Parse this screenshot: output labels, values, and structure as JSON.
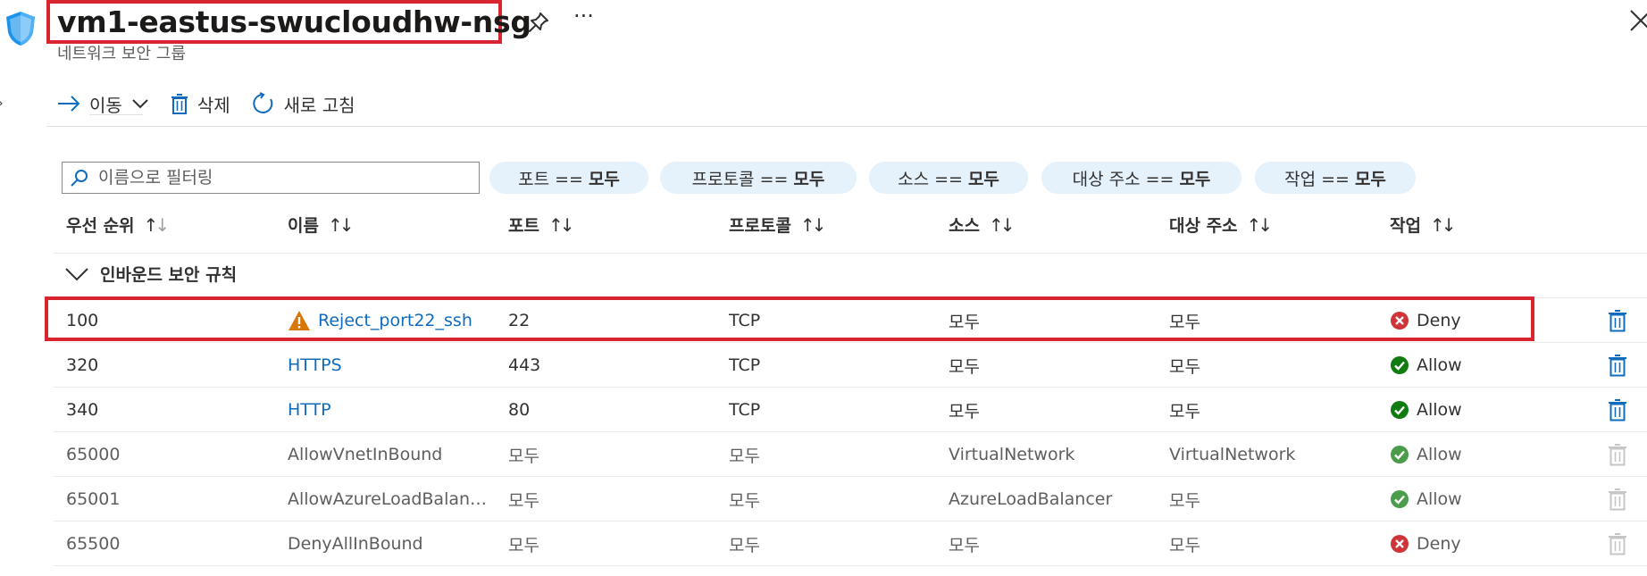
{
  "header": {
    "title": "vm1-eastus-swucloudhw-nsg",
    "subtitle": "네트워크 보안 그룹",
    "more": "···"
  },
  "toolbar": {
    "move_label": "이동",
    "delete_label": "삭제",
    "refresh_label": "새로 고침"
  },
  "filters": {
    "search_placeholder": "이름으로 필터링",
    "pills": [
      {
        "name": "포트 ==",
        "value": "모두"
      },
      {
        "name": "프로토콜 ==",
        "value": "모두"
      },
      {
        "name": "소스 ==",
        "value": "모두"
      },
      {
        "name": "대상 주소 ==",
        "value": "모두"
      },
      {
        "name": "작업 ==",
        "value": "모두"
      }
    ]
  },
  "table": {
    "columns": [
      "우선 순위",
      "이름",
      "포트",
      "프로토콜",
      "소스",
      "대상 주소",
      "작업"
    ],
    "group_label": "인바운드 보안 규칙",
    "rows": [
      {
        "priority": "100",
        "name": "Reject_port22_ssh",
        "port": "22",
        "protocol": "TCP",
        "source": "모두",
        "destination": "모두",
        "action": "Deny",
        "warning": true,
        "editable": true
      },
      {
        "priority": "320",
        "name": "HTTPS",
        "port": "443",
        "protocol": "TCP",
        "source": "모두",
        "destination": "모두",
        "action": "Allow",
        "warning": false,
        "editable": true
      },
      {
        "priority": "340",
        "name": "HTTP",
        "port": "80",
        "protocol": "TCP",
        "source": "모두",
        "destination": "모두",
        "action": "Allow",
        "warning": false,
        "editable": true
      },
      {
        "priority": "65000",
        "name": "AllowVnetInBound",
        "port": "모두",
        "protocol": "모두",
        "source": "VirtualNetwork",
        "destination": "VirtualNetwork",
        "action": "Allow",
        "warning": false,
        "editable": false
      },
      {
        "priority": "65001",
        "name": "AllowAzureLoadBalancerInBound",
        "port": "모두",
        "protocol": "모두",
        "source": "AzureLoadBalancer",
        "destination": "모두",
        "action": "Allow",
        "warning": false,
        "editable": false
      },
      {
        "priority": "65500",
        "name": "DenyAllInBound",
        "port": "모두",
        "protocol": "모두",
        "source": "모두",
        "destination": "모두",
        "action": "Deny",
        "warning": false,
        "editable": false
      }
    ]
  },
  "colors": {
    "accent": "#0f6cbd",
    "highlight": "#d9252f",
    "allow": "#107c10",
    "deny": "#d13438",
    "pill_bg": "#e5f1fb"
  }
}
